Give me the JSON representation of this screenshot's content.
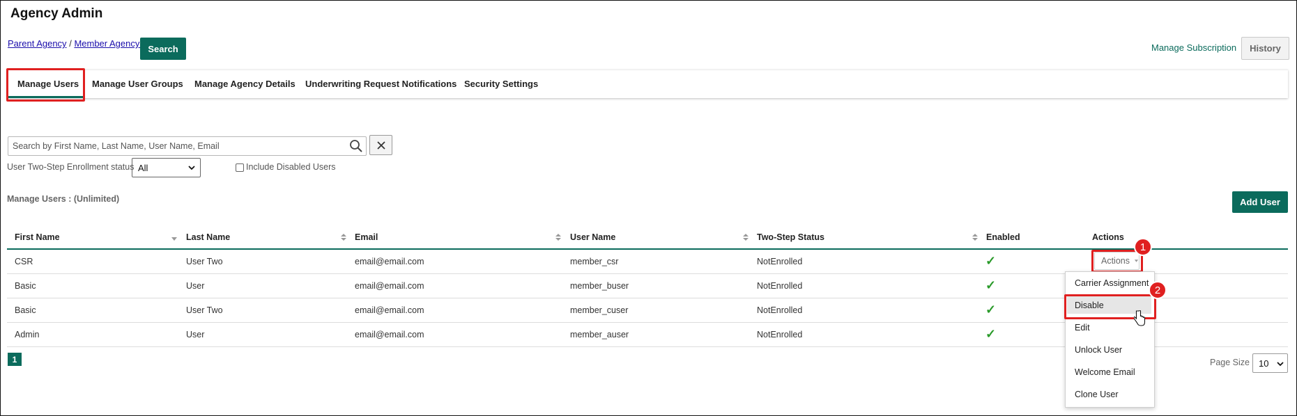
{
  "app": {
    "title": "Agency Admin"
  },
  "breadcrumb": {
    "parent": "Parent Agency",
    "separator": "/",
    "member": "Member Agency A"
  },
  "header": {
    "search_label": "Search",
    "manage_subscription": "Manage Subscription",
    "history_label": "History"
  },
  "tabs": [
    {
      "label": "Manage Users",
      "active": true
    },
    {
      "label": "Manage User Groups"
    },
    {
      "label": "Manage Agency Details"
    },
    {
      "label": "Underwriting Request Notifications"
    },
    {
      "label": "Security Settings"
    }
  ],
  "search": {
    "placeholder": "Search by First Name, Last Name, User Name, Email",
    "value": ""
  },
  "filters": {
    "enrollment_label": "User Two-Step Enrollment status",
    "enrollment_value": "All",
    "include_disabled_label": "Include Disabled Users",
    "include_disabled_checked": false
  },
  "section": {
    "label": "Manage Users : (Unlimited)",
    "add_user": "Add User"
  },
  "table": {
    "columns": [
      "First Name",
      "Last Name",
      "Email",
      "User Name",
      "Two-Step Status",
      "Enabled",
      "Actions"
    ],
    "rows": [
      {
        "first": "CSR",
        "last": "User Two",
        "email": "email@email.com",
        "username": "member_csr",
        "status": "NotEnrolled",
        "enabled": "✓"
      },
      {
        "first": "Basic",
        "last": "User",
        "email": "email@email.com",
        "username": "member_buser",
        "status": "NotEnrolled",
        "enabled": "✓"
      },
      {
        "first": "Basic",
        "last": "User Two",
        "email": "email@email.com",
        "username": "member_cuser",
        "status": "NotEnrolled",
        "enabled": "✓"
      },
      {
        "first": "Admin",
        "last": "User",
        "email": "email@email.com",
        "username": "member_auser",
        "status": "NotEnrolled",
        "enabled": "✓"
      }
    ]
  },
  "actions": {
    "button_label": "Actions",
    "menu": [
      "Carrier Assignment",
      "Disable",
      "Edit",
      "Unlock User",
      "Welcome Email",
      "Clone User"
    ],
    "hovered": "Disable"
  },
  "annotations": {
    "step1": "1",
    "step2": "2"
  },
  "pagination": {
    "current_page": "1",
    "page_size_label": "Page Size",
    "page_size": "10"
  },
  "colors": {
    "accent": "#0b6b5c",
    "highlight": "#e02020",
    "check": "#2a9a2a"
  },
  "icons": [
    "magnifier-icon",
    "close-icon",
    "chevron-down-icon",
    "sort-icon",
    "check-icon",
    "pointer-cursor-icon"
  ]
}
